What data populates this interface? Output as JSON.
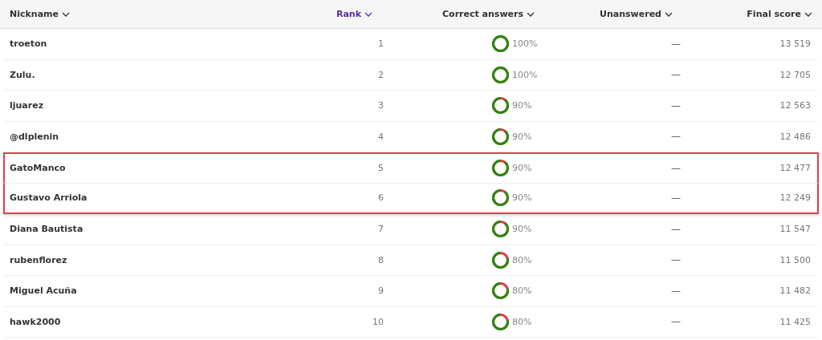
{
  "columns": [
    {
      "label": "Nickname",
      "selected": false
    },
    {
      "label": "Rank",
      "selected": true
    },
    {
      "label": "Correct answers",
      "selected": false
    },
    {
      "label": "Unanswered",
      "selected": false
    },
    {
      "label": "Final score",
      "selected": false
    }
  ],
  "rows": [
    {
      "nickname": "troeton",
      "rank": "1",
      "correct": "100%",
      "unanswered": "—",
      "score": "13 519",
      "highlighted": false
    },
    {
      "nickname": "Zulu.",
      "rank": "2",
      "correct": "100%",
      "unanswered": "—",
      "score": "12 705",
      "highlighted": false
    },
    {
      "nickname": "ljuarez",
      "rank": "3",
      "correct": "90%",
      "unanswered": "—",
      "score": "12 563",
      "highlighted": false
    },
    {
      "nickname": "@dlplenin",
      "rank": "4",
      "correct": "90%",
      "unanswered": "—",
      "score": "12 486",
      "highlighted": false
    },
    {
      "nickname": "GatoManco",
      "rank": "5",
      "correct": "90%",
      "unanswered": "—",
      "score": "12 477",
      "highlighted": true
    },
    {
      "nickname": "Gustavo Arriola",
      "rank": "6",
      "correct": "90%",
      "unanswered": "—",
      "score": "12 249",
      "highlighted": true
    },
    {
      "nickname": "Diana Bautista",
      "rank": "7",
      "correct": "90%",
      "unanswered": "—",
      "score": "11 547",
      "highlighted": false
    },
    {
      "nickname": "rubenflorez",
      "rank": "8",
      "correct": "80%",
      "unanswered": "—",
      "score": "11 500",
      "highlighted": false
    },
    {
      "nickname": "Miguel Acuña",
      "rank": "9",
      "correct": "80%",
      "unanswered": "—",
      "score": "11 482",
      "highlighted": false
    },
    {
      "nickname": "hawk2000",
      "rank": "10",
      "correct": "80%",
      "unanswered": "—",
      "score": "11 425",
      "highlighted": false
    }
  ]
}
